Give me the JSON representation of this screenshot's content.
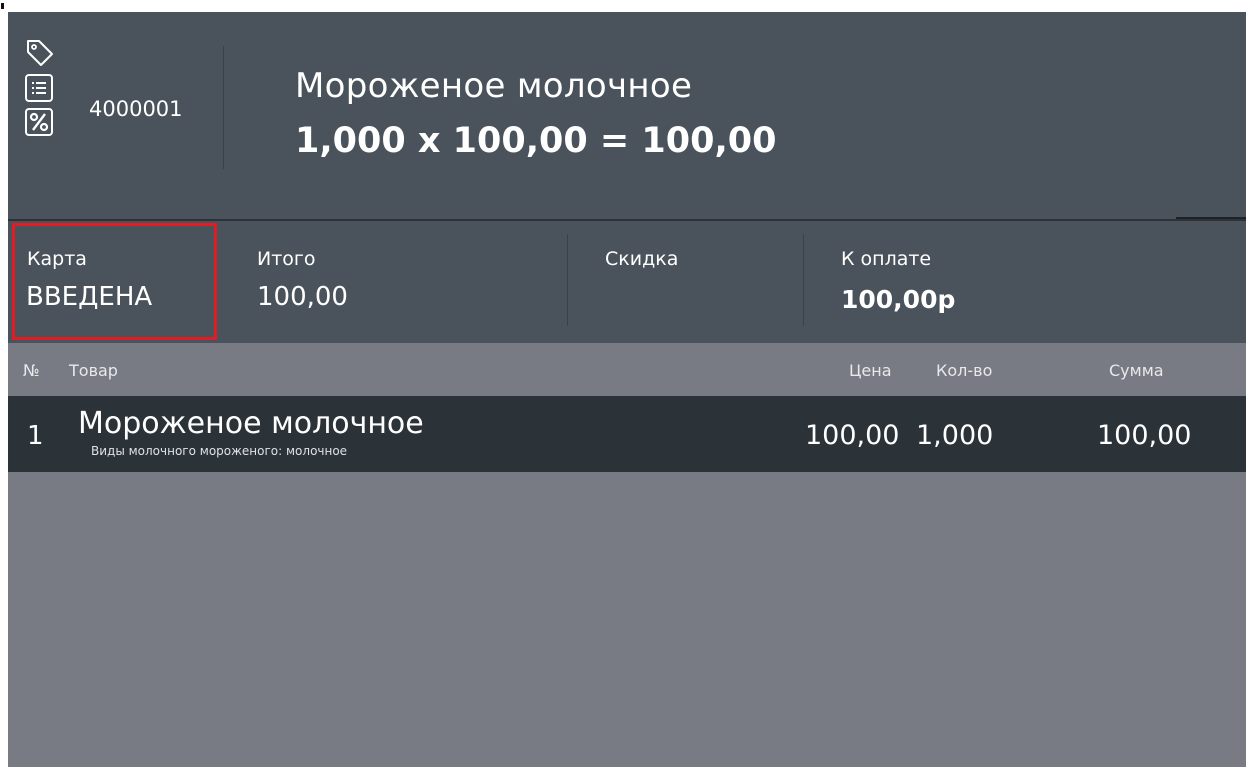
{
  "header": {
    "icons": [
      "tag-icon",
      "list-icon",
      "percent-icon"
    ],
    "code": "4000001",
    "product_name": "Мороженое молочное",
    "formula": "1,000 x 100,00 = 100,00"
  },
  "totals": {
    "card": {
      "label": "Карта",
      "value": "ВВЕДЕНА"
    },
    "total": {
      "label": "Итого",
      "value": "100,00"
    },
    "discount": {
      "label": "Скидка",
      "value": ""
    },
    "to_pay": {
      "label": "К оплате",
      "value": "100,00р"
    }
  },
  "table": {
    "columns": {
      "num": "№",
      "item": "Товар",
      "price": "Цена",
      "qty": "Кол-во",
      "sum": "Сумма"
    },
    "rows": [
      {
        "num": "1",
        "name": "Мороженое молочное",
        "subtitle": "Виды молочного мороженого: молочное",
        "price": "100,00",
        "qty": "1,000",
        "sum": "100,00"
      }
    ]
  },
  "colors": {
    "header_bg": "#4a535b",
    "body_bg": "#787b83",
    "row_bg": "#2b3238",
    "highlight": "#e01c24"
  }
}
